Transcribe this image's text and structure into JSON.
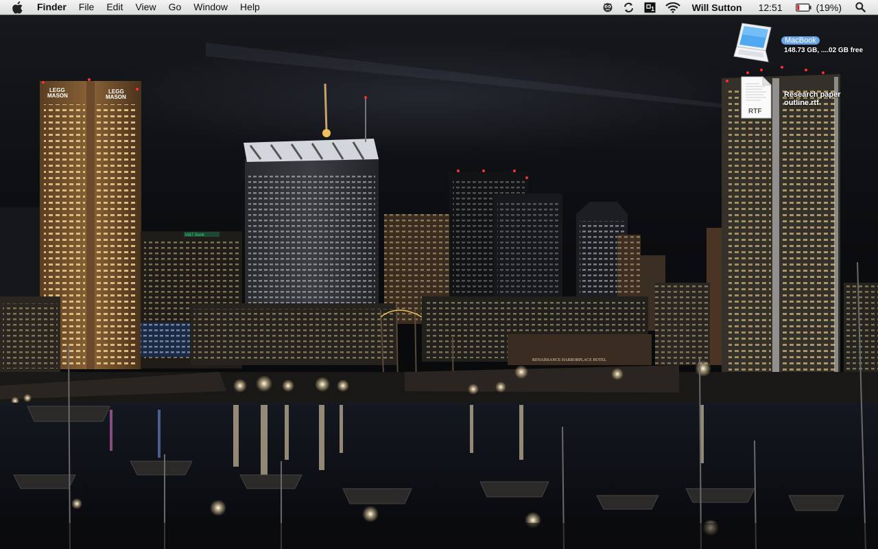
{
  "menubar": {
    "apple_icon": "apple-logo",
    "app_name": "Finder",
    "menus": [
      "File",
      "Edit",
      "View",
      "Go",
      "Window",
      "Help"
    ],
    "status_icons": [
      "growl-icon",
      "sync-icon",
      "keyboard-1-icon",
      "wifi-icon"
    ],
    "user_name": "Will Sutton",
    "clock": "12:51",
    "battery_percent_text": "(19%)",
    "battery_level": 0.19,
    "search_icon": "spotlight-search-icon"
  },
  "desktop": {
    "items": [
      {
        "kind": "drive",
        "icon": "macbook-laptop-icon",
        "name": "MacBook",
        "info": "148.73 GB, ....02 GB free",
        "selected": true
      },
      {
        "kind": "document",
        "icon": "rtf-document-icon",
        "badge": "RTF",
        "name_line1": "Research paper",
        "name_line2": "outline.rtf"
      }
    ]
  },
  "wallpaper": {
    "subject": "night-city-harbor",
    "colors": {
      "sky": "#0c0d10",
      "window_light": "#f0d08a",
      "water": "#0b0d12",
      "crown_light": "#ffffff",
      "beacon": "#ff3030",
      "sign_green": "#3ccf7a"
    },
    "signs": {
      "tower_left": "LEGG MASON",
      "tower_left_top": "LEGG",
      "tower_left_bottom": "MASON",
      "bank": "M&T Bank",
      "hotel": "RENAISSANCE HARBORPLACE HOTEL"
    }
  }
}
